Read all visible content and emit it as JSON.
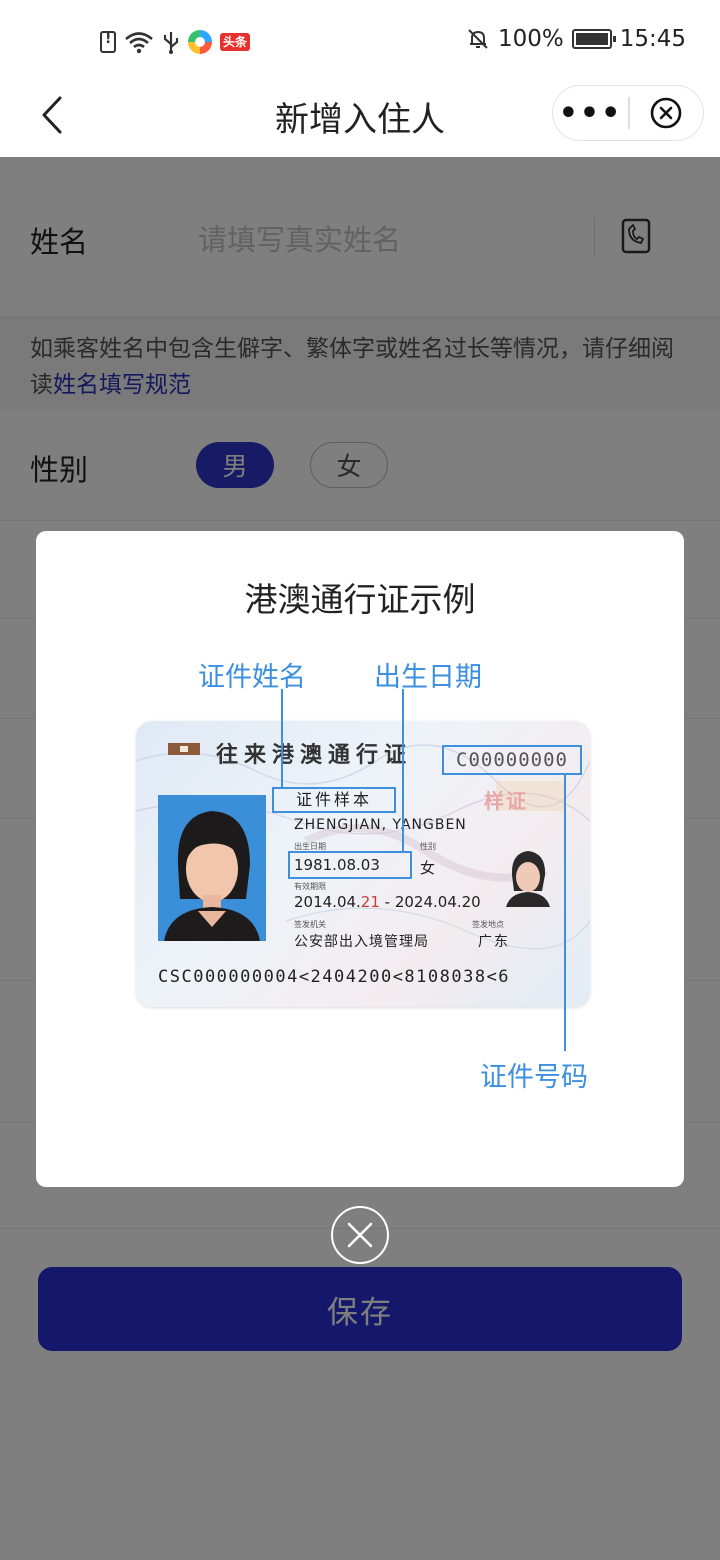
{
  "status_bar": {
    "battery_percent": "100%",
    "time": "15:45",
    "app_badge": "头条"
  },
  "nav": {
    "title": "新增入住人"
  },
  "form": {
    "name_label": "姓名",
    "name_placeholder": "请填写真实姓名",
    "notice_text": "如乘客姓名中包含生僻字、繁体字或姓名过长等情况，请仔细阅读",
    "notice_link": "姓名填写规范",
    "gender_label": "性别",
    "gender_options": [
      "男",
      "女"
    ],
    "gender_selected": "男",
    "save_label": "保存"
  },
  "modal": {
    "title": "港澳通行证示例",
    "callout_name": "证件姓名",
    "callout_dob": "出生日期",
    "callout_number": "证件号码",
    "card": {
      "title": "往来港澳通行证",
      "number": "C00000000",
      "seal": "样证",
      "name_cn": "证件样本",
      "name_pinyin": "ZHENGJIAN, YANGBEN",
      "label_dob": "出生日期",
      "label_sex": "性别",
      "dob": "1981.08.03",
      "sex": "女",
      "label_valid": "有效期限",
      "valid_start_prefix": "2014.04.",
      "valid_start_red": "21",
      "valid_end": " - 2024.04.20",
      "label_authority": "签发机关",
      "label_place": "签发地点",
      "authority": "公安部出入境管理局",
      "place": "广东",
      "mrz": "CSC000000004<2404200<8108038<6"
    }
  },
  "colors": {
    "primary": "#2e35c9",
    "callout": "#3d8fe0",
    "link": "#2a31b8"
  }
}
